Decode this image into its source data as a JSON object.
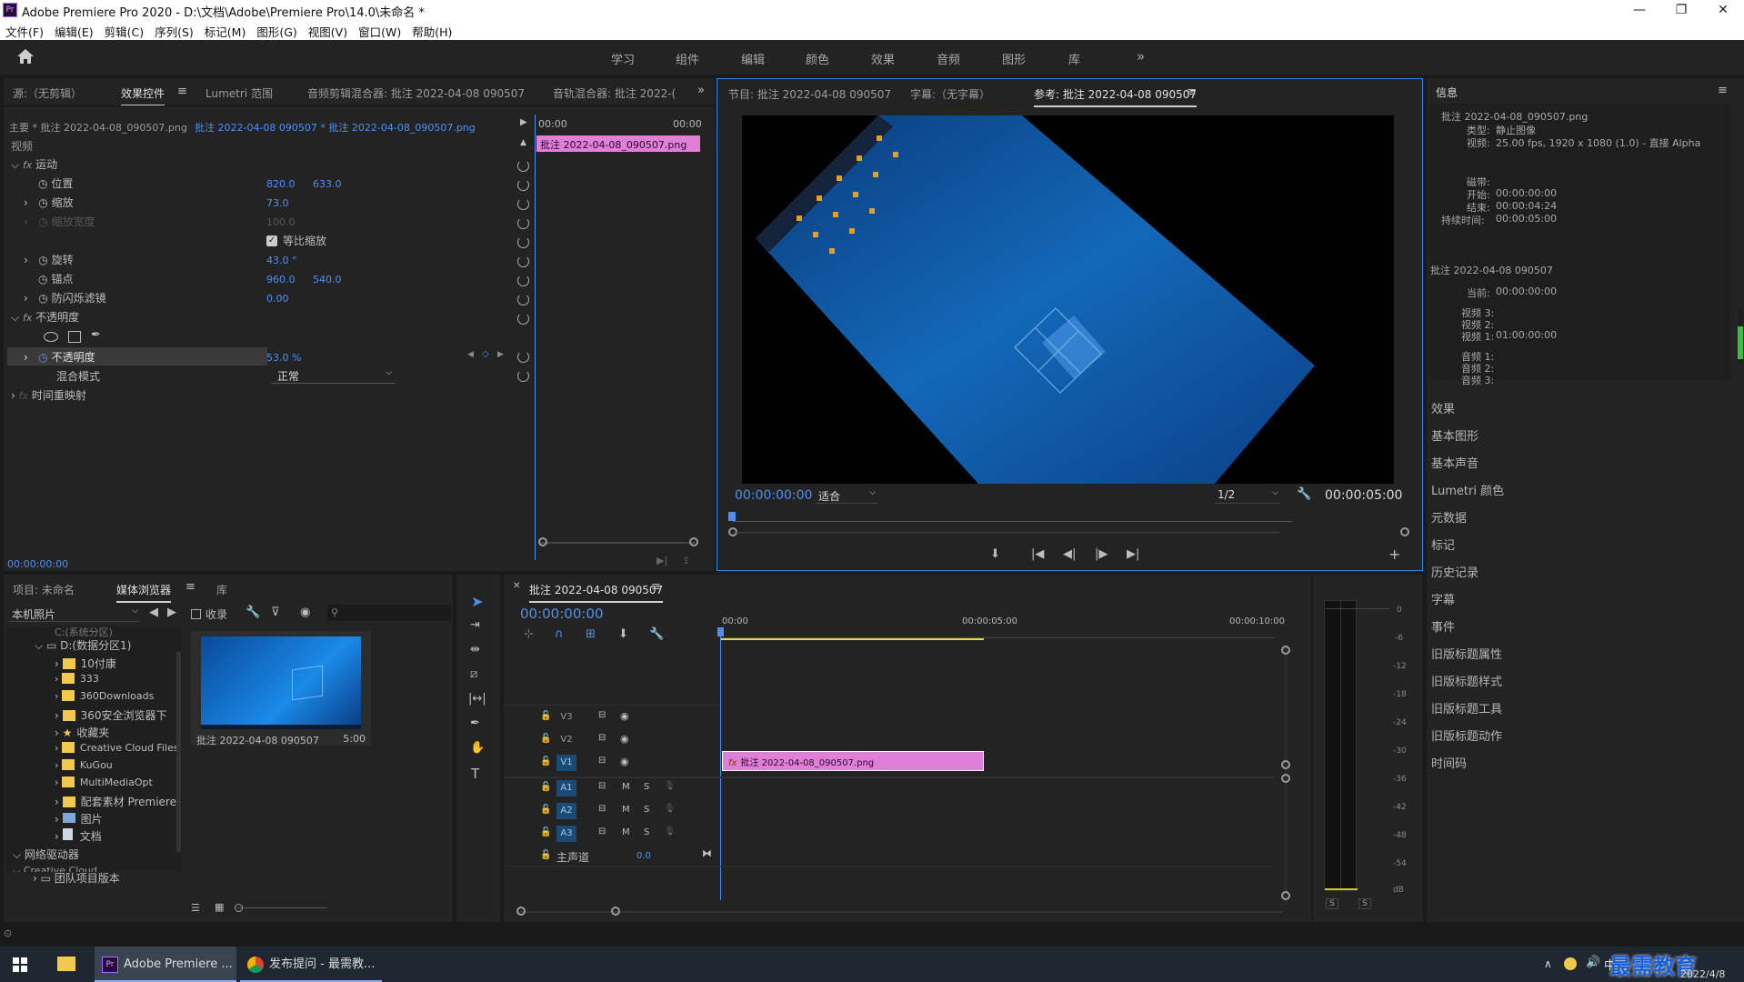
{
  "app": {
    "title": "Adobe Premiere Pro 2020 - D:\\文档\\Adobe\\Premiere Pro\\14.0\\未命名 *",
    "icon_label": "Pr",
    "win_controls": [
      "—",
      "❐",
      "✕"
    ]
  },
  "menu": [
    "文件(F)",
    "编辑(E)",
    "剪辑(C)",
    "序列(S)",
    "标记(M)",
    "图形(G)",
    "视图(V)",
    "窗口(W)",
    "帮助(H)"
  ],
  "workspaces": [
    "学习",
    "组件",
    "编辑",
    "颜色",
    "效果",
    "音频",
    "图形",
    "库"
  ],
  "workspace_more": "»",
  "source_panel": {
    "tabs": [
      "源:（无剪辑）",
      "效果控件",
      "Lumetri 范围",
      "音频剪辑混合器: 批注 2022-04-08 090507",
      "音轨混合器: 批注 2022-("
    ],
    "active_tab": "效果控件",
    "master_label": "主要 * 批注 2022-04-08_090507.png",
    "clip_label": "批注 2022-04-08 090507 * 批注 2022-04-08_090507.png",
    "time_start": "00:00",
    "time_end": "00:00",
    "clip_bar": "批注 2022-04-08_090507.png",
    "section_video": "视频",
    "motion": "运动",
    "position": {
      "label": "位置",
      "x": "820.0",
      "y": "633.0"
    },
    "scale": {
      "label": "缩放",
      "value": "73.0"
    },
    "scale_width": {
      "label": "缩放宽度",
      "value": "100.0"
    },
    "uniform_scale": "等比缩放",
    "rotation": {
      "label": "旋转",
      "value": "43.0 °"
    },
    "anchor": {
      "label": "锚点",
      "x": "960.0",
      "y": "540.0"
    },
    "flicker": {
      "label": "防闪烁滤镜",
      "value": "0.00"
    },
    "opacity_group": "不透明度",
    "opacity": {
      "label": "不透明度",
      "value": "53.0 %"
    },
    "blend": {
      "label": "混合模式",
      "value": "正常"
    },
    "time_remap": "时间重映射",
    "timecode": "00:00:00:00"
  },
  "program_panel": {
    "tabs": [
      "节目: 批注 2022-04-08 090507",
      "字幕:（无字幕）",
      "参考: 批注 2022-04-08 090507"
    ],
    "active_tab": "参考: 批注 2022-04-08 090507",
    "timecode": "00:00:00:00",
    "fit": "适合",
    "resolution": "1/2",
    "duration": "00:00:05:00"
  },
  "info_panel": {
    "title": "信息",
    "clip_name": "批注 2022-04-08_090507.png",
    "lines": [
      {
        "k": "类型:",
        "v": "静止图像"
      },
      {
        "k": "视频:",
        "v": "25.00 fps, 1920 x 1080 (1.0) - 直接 Alpha"
      }
    ],
    "tape": "磁带:",
    "in": {
      "k": "开始:",
      "v": "00:00:00:00"
    },
    "out": {
      "k": "结束:",
      "v": "00:00:04:24"
    },
    "dur": {
      "k": "持续时间:",
      "v": "00:00:05:00"
    },
    "seq_name": "批注 2022-04-08 090507",
    "current": {
      "k": "当前:",
      "v": "00:00:00:00"
    },
    "v3": "视频 3:",
    "v2": "视频 2:",
    "v1": {
      "k": "视频 1:",
      "v": "01:00:00:00"
    },
    "a1": "音频 1:",
    "a2": "音频 2:",
    "a3": "音频 3:"
  },
  "right_items": [
    "效果",
    "基本图形",
    "基本声音",
    "Lumetri 颜色",
    "元数据",
    "标记",
    "历史记录",
    "字幕",
    "事件",
    "旧版标题属性",
    "旧版标题样式",
    "旧版标题工具",
    "旧版标题动作",
    "时间码"
  ],
  "project_panel": {
    "tabs": [
      "项目: 未命名",
      "媒体浏览器",
      "库"
    ],
    "active_tab": "媒体浏览器",
    "location": "本机照片",
    "ingest": "收录",
    "tree_top": "D:(数据分区1)",
    "tree_above": "C:(系统分区)",
    "folders": [
      "10付康",
      "333",
      "360Downloads",
      "360安全浏览器下",
      "收藏夹",
      "Creative Cloud Files",
      "KuGou",
      "MultiMediaOpt",
      "配套素材 Premiere",
      "图片",
      "文档"
    ],
    "network": "网络驱动器",
    "cc": "Creative Cloud",
    "team": "团队项目版本",
    "thumb_name": "批注 2022-04-08 090507",
    "thumb_dur": "5:00"
  },
  "timeline": {
    "tab": "批注 2022-04-08 090507",
    "timecode": "00:00:00:00",
    "ruler": [
      "00:00",
      "00:00:05:00",
      "00:00:10:00"
    ],
    "video_tracks": [
      "V3",
      "V2",
      "V1"
    ],
    "audio_tracks": [
      "A1",
      "A2",
      "A3"
    ],
    "master": "主声道",
    "master_val": "0.0",
    "clip": "批注 2022-04-08_090507.png"
  },
  "meter": {
    "labels": [
      "0",
      "-6",
      "-12",
      "-18",
      "-24",
      "-30",
      "-36",
      "-42",
      "-48",
      "-54",
      "dB"
    ],
    "solo": [
      "S",
      "S"
    ]
  },
  "taskbar": {
    "apps": [
      "Adobe Premiere ...",
      "发布提问 - 最需教..."
    ],
    "ime": "中",
    "date": "2022/4/8",
    "watermark": "最需教育"
  },
  "colors": {
    "accent": "#4e8ff0",
    "clip": "#e07fd7",
    "panel": "#232323",
    "bg": "#1a1a1a"
  }
}
